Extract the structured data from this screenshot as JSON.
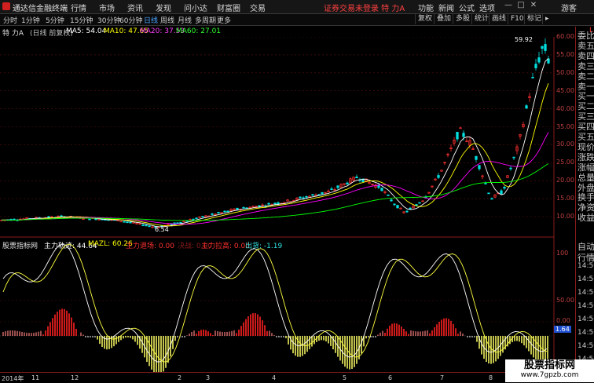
{
  "app": {
    "name": "通达信金融终端"
  },
  "menu": [
    "行情",
    "市场",
    "资讯",
    "发现",
    "问小达",
    "财富圈",
    "交易"
  ],
  "status_text": "证券交易未登录  特 力A",
  "right_menu": [
    "功能",
    "新闻",
    "公式",
    "选项"
  ],
  "user": "游客",
  "period_tabs": [
    "分时",
    "1分钟",
    "5分钟",
    "15分钟",
    "30分钟",
    "60分钟",
    "日线",
    "周线",
    "月线",
    "多周期",
    "更多"
  ],
  "tools": [
    "复权",
    "叠加",
    "多股",
    "统计",
    "画线",
    "F10",
    "标记"
  ],
  "main_legend": {
    "stock": "特 力A",
    "mode": "(日线 前复权)",
    "ma5": "MA5: 54.04",
    "ma10": "MA10: 47.65",
    "ma20": "MA20: 37.53",
    "ma60": "MA60: 27.01"
  },
  "sub_legend": {
    "name": "股票指标网",
    "track": "主力轨迹: 44.64",
    "mazl": "MAZL: 60.26",
    "retreat": "主力退场: 0.00",
    "decide": "决战: 0.00",
    "pull": "主力拉高: 0.00",
    "out": "出货: -1.19"
  },
  "y_axis_main": [
    "60.00",
    "55.00",
    "50.00",
    "45.00",
    "40.00",
    "35.00",
    "30.00",
    "25.00",
    "20.00",
    "15.00",
    "10.00"
  ],
  "y_axis_sub": [
    "100",
    "50.00",
    "0.00"
  ],
  "sub_current": "1.64",
  "price_high": "59.92",
  "price_low": "6.54",
  "x_axis": [
    "2014年",
    "11",
    "12",
    "2",
    "3",
    "4",
    "5",
    "6",
    "7",
    "8",
    "9"
  ],
  "right_panel": {
    "title": "L",
    "items": [
      "委比",
      "卖五",
      "卖四",
      "卖三",
      "卖二",
      "卖一",
      "买一",
      "买二",
      "买三",
      "买四",
      "买五",
      "现价",
      "涨跌",
      "涨幅",
      "总量",
      "外盘",
      "换手",
      "净资",
      "收益"
    ],
    "sub_items": [
      "自动",
      "行情"
    ],
    "times": [
      "14:50",
      "14:50",
      "14:50",
      "14:50",
      "14:50",
      "14:50",
      "14:50",
      "14:50"
    ]
  },
  "watermark": {
    "title": "股票指标网",
    "url": "www.7gpzb.com"
  },
  "colors": {
    "up": "#ff3030",
    "down": "#00e0e0",
    "ma5": "#ffffff",
    "ma10": "#ffff00",
    "ma20": "#ff00ff",
    "ma60": "#00ff00"
  }
}
